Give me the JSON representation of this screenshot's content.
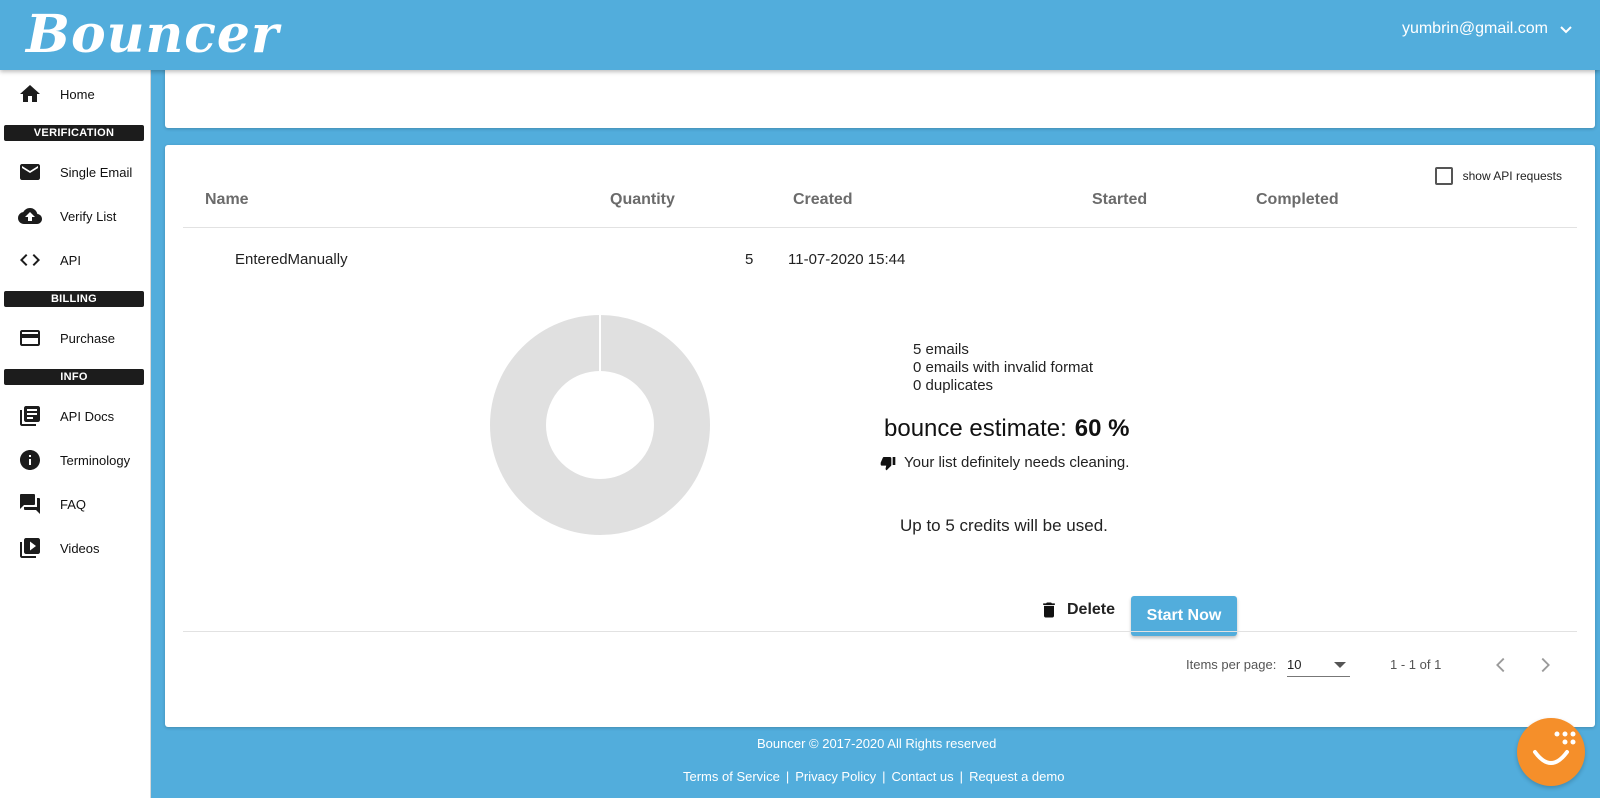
{
  "header": {
    "logo": "Bouncer",
    "user_email": "yumbrin@gmail.com"
  },
  "sidebar": {
    "home": "Home",
    "section_verification": "VERIFICATION",
    "single_email": "Single Email",
    "verify_list": "Verify List",
    "api": "API",
    "section_billing": "BILLING",
    "purchase": "Purchase",
    "section_info": "INFO",
    "api_docs": "API Docs",
    "terminology": "Terminology",
    "faq": "FAQ",
    "videos": "Videos"
  },
  "table": {
    "show_api_label": "show API requests",
    "columns": {
      "name": "Name",
      "quantity": "Quantity",
      "created": "Created",
      "started": "Started",
      "completed": "Completed"
    },
    "row": {
      "name": "EnteredManually",
      "quantity": "5",
      "created": "11-07-2020 15:44"
    }
  },
  "details": {
    "emails": "5 emails",
    "invalid": "0 emails with invalid format",
    "duplicates": "0 duplicates",
    "bounce_label": "bounce estimate:",
    "bounce_value": "60 %",
    "verdict": "Your list definitely needs cleaning.",
    "credits": "Up to 5 credits will be used."
  },
  "actions": {
    "delete": "Delete",
    "start": "Start Now"
  },
  "pager": {
    "items_label": "Items per page:",
    "items_value": "10",
    "range": "1 - 1 of 1"
  },
  "footer": {
    "copyright": "Bouncer © 2017-2020 All Rights reserved",
    "terms": "Terms of Service",
    "privacy": "Privacy Policy",
    "contact": "Contact us",
    "demo": "Request a demo"
  },
  "colors": {
    "brand": "#52addc",
    "chat": "#f58f2a"
  }
}
